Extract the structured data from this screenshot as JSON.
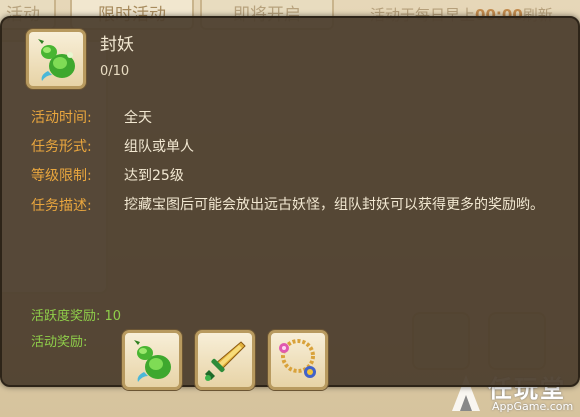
{
  "background": {
    "tabs": [
      {
        "label": "活动"
      },
      {
        "label": "限时活动"
      },
      {
        "label": "即将开启"
      }
    ],
    "notice_prefix": "活动于每日早上",
    "notice_time": "00:00",
    "notice_suffix": "刷新",
    "watermark": {
      "brand": "任玩堂",
      "site": "AppGame.com"
    }
  },
  "popup": {
    "title": "封妖",
    "progress": "0/10",
    "details": [
      {
        "label": "活动时间:",
        "value": "全天"
      },
      {
        "label": "任务形式:",
        "value": "组队或单人"
      },
      {
        "label": "等级限制:",
        "value": "达到25级"
      },
      {
        "label": "任务描述:",
        "value": ""
      }
    ],
    "description": "挖藏宝图后可能会放出远古妖怪，组队封妖可以获得更多的奖励哟。",
    "activity_reward": "活跃度奖励: 10",
    "rewards_label": "活动奖励:",
    "rewards": [
      {
        "icon": "green-gourd-icon"
      },
      {
        "icon": "green-sword-icon"
      },
      {
        "icon": "gold-necklace-icon"
      }
    ]
  }
}
